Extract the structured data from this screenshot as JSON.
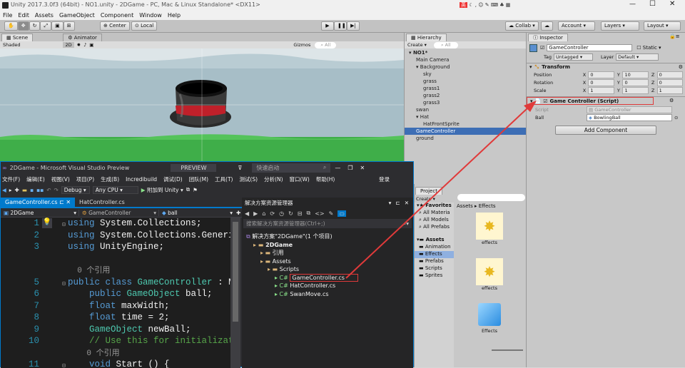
{
  "window": {
    "title": "Unity 2017.3.0f3 (64bit) - NO1.unity - 2DGame - PC, Mac & Linux Standalone* <DX11>"
  },
  "menu": [
    "File",
    "Edit",
    "Assets",
    "GameObject",
    "Component",
    "Window",
    "Help"
  ],
  "toolbar": {
    "center": "Center",
    "local": "Local",
    "collab": "Collab",
    "account": "Account",
    "layers": "Layers",
    "layout": "Layout"
  },
  "scene": {
    "tab_scene": "Scene",
    "tab_animator": "Animator",
    "shaded": "Shaded",
    "mode_2d": "2D",
    "gizmos": "Gizmos",
    "search": "All"
  },
  "hierarchy": {
    "tab": "Hierarchy",
    "create": "Create",
    "search": "All",
    "items": [
      {
        "label": "NO1*",
        "indent": 0,
        "bold": true
      },
      {
        "label": "Main Camera",
        "indent": 1
      },
      {
        "label": "Background",
        "indent": 1
      },
      {
        "label": "sky",
        "indent": 2
      },
      {
        "label": "grass",
        "indent": 2
      },
      {
        "label": "grass1",
        "indent": 2
      },
      {
        "label": "grass2",
        "indent": 2
      },
      {
        "label": "grass3",
        "indent": 2
      },
      {
        "label": "swan",
        "indent": 1
      },
      {
        "label": "Hat",
        "indent": 1
      },
      {
        "label": "HatFrontSprite",
        "indent": 2
      },
      {
        "label": "GameController",
        "indent": 1,
        "selected": true
      },
      {
        "label": "ground",
        "indent": 1
      }
    ]
  },
  "inspector": {
    "tab": "Inspector",
    "object_name": "GameController",
    "static": "Static",
    "tag_label": "Tag",
    "tag_value": "Untagged",
    "layer_label": "Layer",
    "layer_value": "Default",
    "transform": {
      "title": "Transform",
      "rows": [
        {
          "label": "Position",
          "x": "0",
          "y": "10",
          "z": "0"
        },
        {
          "label": "Rotation",
          "x": "0",
          "y": "0",
          "z": "0"
        },
        {
          "label": "Scale",
          "x": "1",
          "y": "1",
          "z": "1"
        }
      ]
    },
    "script": {
      "title": "Game Controller (Script)",
      "script_label": "Script",
      "script_value": "GameController",
      "ball_label": "Ball",
      "ball_value": "BowlingBall"
    },
    "add_component": "Add Component"
  },
  "project": {
    "tab": "Project",
    "create": "Create",
    "favorites": "Favorites",
    "fav_items": [
      "All Materia",
      "All Models",
      "All Prefabs"
    ],
    "assets": "Assets",
    "asset_items": [
      "Animation",
      "Effects",
      "Prefabs",
      "Scripts",
      "Sprites"
    ],
    "breadcrumb": "Assets ▸ Effects",
    "tiles": [
      "effects",
      "effects",
      "Effects"
    ]
  },
  "vs": {
    "title": "2DGame - Microsoft Visual Studio Preview",
    "preview": "PREVIEW",
    "quicklaunch": "快速启动",
    "menus": [
      "文件(F)",
      "编辑(E)",
      "视图(V)",
      "项目(P)",
      "生成(B)",
      "Incredibuild",
      "调试(D)",
      "团队(M)",
      "工具(T)",
      "测试(S)",
      "分析(N)",
      "窗口(W)",
      "帮助(H)"
    ],
    "login": "登录",
    "config": "Debug",
    "platform": "Any CPU",
    "attach": "附加到 Unity",
    "tabs": [
      "GameController.cs",
      "HatController.cs"
    ],
    "nav": [
      "2DGame",
      "GameController",
      "ball"
    ],
    "code": [
      {
        "n": "1",
        "t": [
          [
            "kw",
            "using"
          ],
          [
            "pl",
            " System.Collections;"
          ]
        ]
      },
      {
        "n": "2",
        "t": [
          [
            "kw",
            "using"
          ],
          [
            "pl",
            " System.Collections.Generic;"
          ]
        ]
      },
      {
        "n": "3",
        "t": [
          [
            "kw",
            "using"
          ],
          [
            "pl",
            " UnityEngine;"
          ]
        ]
      },
      {
        "n": "",
        "t": [
          [
            "pl",
            ""
          ]
        ]
      },
      {
        "n": "",
        "t": [
          [
            "pl",
            "  0 个引用"
          ]
        ]
      },
      {
        "n": "5",
        "t": [
          [
            "kw",
            "public class "
          ],
          [
            "ty",
            "GameController"
          ],
          [
            "pl",
            " : Monob"
          ]
        ]
      },
      {
        "n": "6",
        "t": [
          [
            "pl",
            "    "
          ],
          [
            "kw",
            "public "
          ],
          [
            "ty",
            "GameObject"
          ],
          [
            "pl",
            " ball;"
          ]
        ]
      },
      {
        "n": "7",
        "t": [
          [
            "pl",
            "    "
          ],
          [
            "kw",
            "float"
          ],
          [
            "pl",
            " maxWidth;"
          ]
        ]
      },
      {
        "n": "8",
        "t": [
          [
            "pl",
            "    "
          ],
          [
            "kw",
            "float"
          ],
          [
            "pl",
            " time = 2;"
          ]
        ]
      },
      {
        "n": "9",
        "t": [
          [
            "pl",
            "    "
          ],
          [
            "ty",
            "GameObject"
          ],
          [
            "pl",
            " newBall;"
          ]
        ]
      },
      {
        "n": "10",
        "t": [
          [
            "pl",
            "    "
          ],
          [
            "cm",
            "// Use this for initialization"
          ]
        ]
      },
      {
        "n": "",
        "t": [
          [
            "pl",
            "    0 个引用"
          ]
        ]
      },
      {
        "n": "11",
        "t": [
          [
            "pl",
            "    "
          ],
          [
            "kw",
            "void"
          ],
          [
            "pl",
            " Start () {"
          ]
        ]
      }
    ],
    "solution": {
      "title": "解决方案资源管理器",
      "search": "搜索解决方案资源管理器(Ctrl+;)",
      "items": [
        {
          "label": "解决方案\"2DGame\"(1 个项目)",
          "indent": 0
        },
        {
          "label": "2DGame",
          "indent": 1,
          "bold": true
        },
        {
          "label": "引用",
          "indent": 2
        },
        {
          "label": "Assets",
          "indent": 2
        },
        {
          "label": "Scripts",
          "indent": 3
        },
        {
          "label": "GameController.cs",
          "indent": 4,
          "boxed": true
        },
        {
          "label": "HatController.cs",
          "indent": 4
        },
        {
          "label": "SwanMove.cs",
          "indent": 4
        }
      ]
    }
  },
  "colors": {
    "selection": "#3d6eb5",
    "vs_bg": "#1e1e1e",
    "annotation": "#e03a3a",
    "accent": "#007acc"
  }
}
